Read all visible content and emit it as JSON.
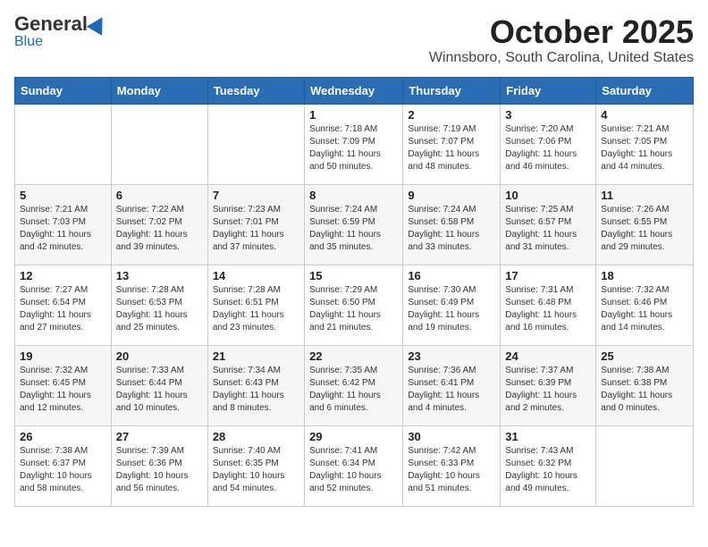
{
  "header": {
    "logo_general": "General",
    "logo_blue": "Blue",
    "month": "October 2025",
    "location": "Winnsboro, South Carolina, United States"
  },
  "days_of_week": [
    "Sunday",
    "Monday",
    "Tuesday",
    "Wednesday",
    "Thursday",
    "Friday",
    "Saturday"
  ],
  "weeks": [
    [
      null,
      null,
      null,
      {
        "day": 1,
        "sunrise": "7:18 AM",
        "sunset": "7:09 PM",
        "daylight": "11 hours and 50 minutes."
      },
      {
        "day": 2,
        "sunrise": "7:19 AM",
        "sunset": "7:07 PM",
        "daylight": "11 hours and 48 minutes."
      },
      {
        "day": 3,
        "sunrise": "7:20 AM",
        "sunset": "7:06 PM",
        "daylight": "11 hours and 46 minutes."
      },
      {
        "day": 4,
        "sunrise": "7:21 AM",
        "sunset": "7:05 PM",
        "daylight": "11 hours and 44 minutes."
      }
    ],
    [
      {
        "day": 5,
        "sunrise": "7:21 AM",
        "sunset": "7:03 PM",
        "daylight": "11 hours and 42 minutes."
      },
      {
        "day": 6,
        "sunrise": "7:22 AM",
        "sunset": "7:02 PM",
        "daylight": "11 hours and 39 minutes."
      },
      {
        "day": 7,
        "sunrise": "7:23 AM",
        "sunset": "7:01 PM",
        "daylight": "11 hours and 37 minutes."
      },
      {
        "day": 8,
        "sunrise": "7:24 AM",
        "sunset": "6:59 PM",
        "daylight": "11 hours and 35 minutes."
      },
      {
        "day": 9,
        "sunrise": "7:24 AM",
        "sunset": "6:58 PM",
        "daylight": "11 hours and 33 minutes."
      },
      {
        "day": 10,
        "sunrise": "7:25 AM",
        "sunset": "6:57 PM",
        "daylight": "11 hours and 31 minutes."
      },
      {
        "day": 11,
        "sunrise": "7:26 AM",
        "sunset": "6:55 PM",
        "daylight": "11 hours and 29 minutes."
      }
    ],
    [
      {
        "day": 12,
        "sunrise": "7:27 AM",
        "sunset": "6:54 PM",
        "daylight": "11 hours and 27 minutes."
      },
      {
        "day": 13,
        "sunrise": "7:28 AM",
        "sunset": "6:53 PM",
        "daylight": "11 hours and 25 minutes."
      },
      {
        "day": 14,
        "sunrise": "7:28 AM",
        "sunset": "6:51 PM",
        "daylight": "11 hours and 23 minutes."
      },
      {
        "day": 15,
        "sunrise": "7:29 AM",
        "sunset": "6:50 PM",
        "daylight": "11 hours and 21 minutes."
      },
      {
        "day": 16,
        "sunrise": "7:30 AM",
        "sunset": "6:49 PM",
        "daylight": "11 hours and 19 minutes."
      },
      {
        "day": 17,
        "sunrise": "7:31 AM",
        "sunset": "6:48 PM",
        "daylight": "11 hours and 16 minutes."
      },
      {
        "day": 18,
        "sunrise": "7:32 AM",
        "sunset": "6:46 PM",
        "daylight": "11 hours and 14 minutes."
      }
    ],
    [
      {
        "day": 19,
        "sunrise": "7:32 AM",
        "sunset": "6:45 PM",
        "daylight": "11 hours and 12 minutes."
      },
      {
        "day": 20,
        "sunrise": "7:33 AM",
        "sunset": "6:44 PM",
        "daylight": "11 hours and 10 minutes."
      },
      {
        "day": 21,
        "sunrise": "7:34 AM",
        "sunset": "6:43 PM",
        "daylight": "11 hours and 8 minutes."
      },
      {
        "day": 22,
        "sunrise": "7:35 AM",
        "sunset": "6:42 PM",
        "daylight": "11 hours and 6 minutes."
      },
      {
        "day": 23,
        "sunrise": "7:36 AM",
        "sunset": "6:41 PM",
        "daylight": "11 hours and 4 minutes."
      },
      {
        "day": 24,
        "sunrise": "7:37 AM",
        "sunset": "6:39 PM",
        "daylight": "11 hours and 2 minutes."
      },
      {
        "day": 25,
        "sunrise": "7:38 AM",
        "sunset": "6:38 PM",
        "daylight": "11 hours and 0 minutes."
      }
    ],
    [
      {
        "day": 26,
        "sunrise": "7:38 AM",
        "sunset": "6:37 PM",
        "daylight": "10 hours and 58 minutes."
      },
      {
        "day": 27,
        "sunrise": "7:39 AM",
        "sunset": "6:36 PM",
        "daylight": "10 hours and 56 minutes."
      },
      {
        "day": 28,
        "sunrise": "7:40 AM",
        "sunset": "6:35 PM",
        "daylight": "10 hours and 54 minutes."
      },
      {
        "day": 29,
        "sunrise": "7:41 AM",
        "sunset": "6:34 PM",
        "daylight": "10 hours and 52 minutes."
      },
      {
        "day": 30,
        "sunrise": "7:42 AM",
        "sunset": "6:33 PM",
        "daylight": "10 hours and 51 minutes."
      },
      {
        "day": 31,
        "sunrise": "7:43 AM",
        "sunset": "6:32 PM",
        "daylight": "10 hours and 49 minutes."
      },
      null
    ]
  ]
}
